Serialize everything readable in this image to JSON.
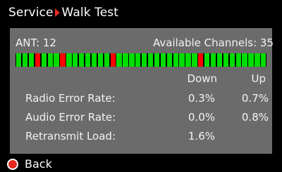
{
  "title": {
    "section": "Service",
    "page": "Walk Test"
  },
  "status": {
    "ant_label": "ANT: 12",
    "channels_label": "Available Channels: 35"
  },
  "meter": {
    "colors": {
      "good": "#00dd00",
      "error": "#ff0000"
    },
    "segments": [
      "good",
      "good",
      "good",
      "error",
      "good",
      "good",
      "good",
      "error",
      "good",
      "good",
      "good",
      "good",
      "good",
      "good",
      "good",
      "error",
      "good",
      "good",
      "good",
      "good",
      "good",
      "good",
      "good",
      "good",
      "good",
      "good",
      "good",
      "good",
      "good",
      "error",
      "good",
      "good",
      "good",
      "good",
      "good",
      "good",
      "good",
      "good",
      "good",
      "good"
    ]
  },
  "table": {
    "col_down": "Down",
    "col_up": "Up",
    "rows": [
      {
        "label": "Radio Error Rate:",
        "down": "0.3%",
        "up": "0.7%"
      },
      {
        "label": "Audio Error Rate:",
        "down": "0.0%",
        "up": "0.8%"
      },
      {
        "label": "Retransmit Load:",
        "down": "1.6%",
        "up": ""
      }
    ]
  },
  "footer": {
    "back_label": "Back",
    "back_icon": "red-circle-button-icon"
  }
}
